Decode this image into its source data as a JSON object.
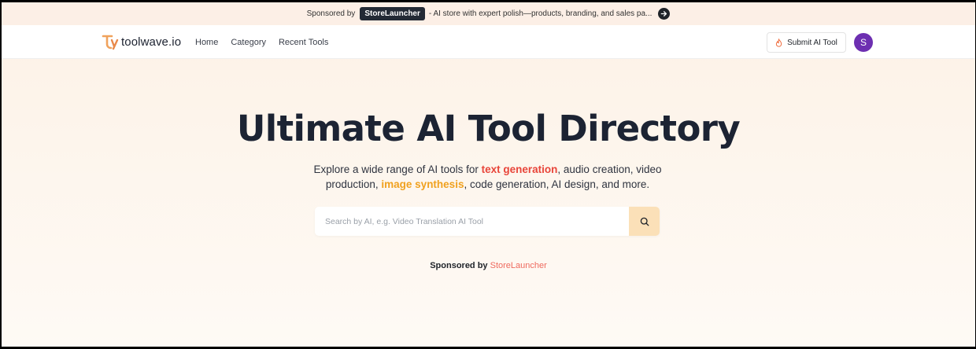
{
  "promo": {
    "label": "Sponsored by",
    "brand": "StoreLauncher",
    "text": "- AI store with expert polish—products, branding, and sales pa...",
    "arrow_icon": "arrow-right-icon"
  },
  "nav": {
    "logo_text": "toolwave.io",
    "links": [
      "Home",
      "Category",
      "Recent Tools"
    ],
    "submit_label": "Submit AI Tool",
    "submit_icon": "fire-icon",
    "avatar_letter": "S"
  },
  "hero": {
    "title": "Ultimate AI Tool Directory",
    "desc_part1": "Explore a wide range of AI tools for ",
    "desc_hl1": "text generation",
    "desc_part2": ", audio creation, video production, ",
    "desc_hl2": "image synthesis",
    "desc_part3": ", code generation, AI design, and more."
  },
  "search": {
    "placeholder": "Search by AI, e.g. Video Translation AI Tool",
    "icon": "search-icon"
  },
  "sponsor": {
    "label": "Sponsored by ",
    "brand": "StoreLauncher"
  },
  "colors": {
    "accent_red": "#e8453a",
    "accent_orange": "#f0a11f",
    "avatar_bg": "#6d2fb1",
    "search_btn_bg": "#fbe0b8"
  }
}
